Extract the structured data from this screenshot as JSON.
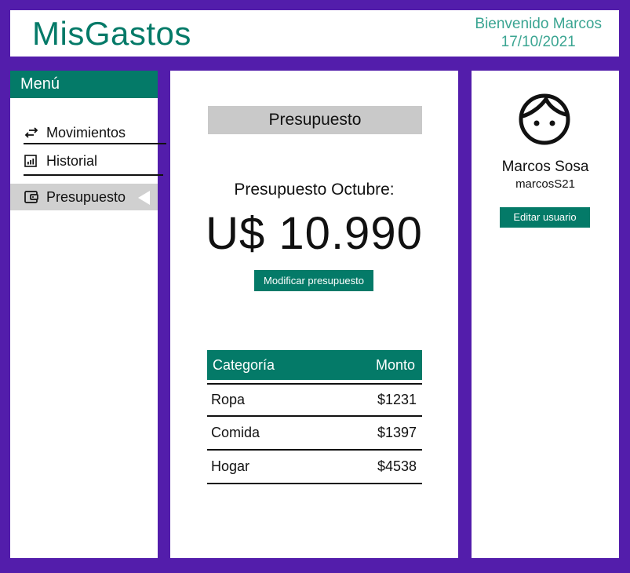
{
  "header": {
    "brand": "MisGastos",
    "welcome": "Bienvenido Marcos",
    "date": "17/10/2021"
  },
  "sidebar": {
    "title": "Menú",
    "items": [
      {
        "label": "Movimientos",
        "icon": "swap-arrows-icon"
      },
      {
        "label": "Historial",
        "icon": "bar-chart-icon"
      },
      {
        "label": "Presupuesto",
        "icon": "wallet-icon",
        "active": true
      }
    ]
  },
  "main": {
    "section_title": "Presupuesto",
    "budget_label": "Presupuesto Octubre:",
    "budget_amount": "U$ 10.990",
    "modify_button": "Modificar presupuesto",
    "table": {
      "headers": [
        "Categoría",
        "Monto"
      ],
      "rows": [
        {
          "category": "Ropa",
          "amount": "$1231"
        },
        {
          "category": "Comida",
          "amount": "$1397"
        },
        {
          "category": "Hogar",
          "amount": "$4538"
        }
      ]
    }
  },
  "profile": {
    "name": "Marcos Sosa",
    "username": "marcosS21",
    "edit_button": "Editar usuario"
  },
  "colors": {
    "frame": "#531dab",
    "accent": "#047a68",
    "accent_light": "#3ba592",
    "active_bg": "#d0d0d0"
  }
}
